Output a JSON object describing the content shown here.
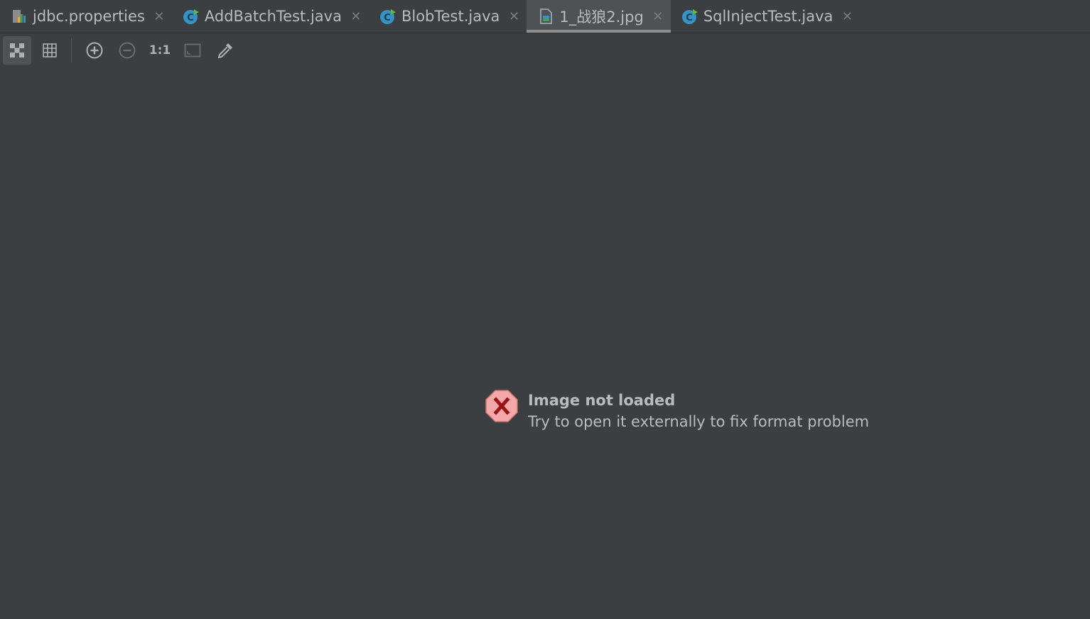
{
  "tabs": [
    {
      "label": "jdbc.properties",
      "icon": "properties-file-icon",
      "active": false
    },
    {
      "label": "AddBatchTest.java",
      "icon": "java-class-icon",
      "active": false
    },
    {
      "label": "BlobTest.java",
      "icon": "java-class-icon",
      "active": false
    },
    {
      "label": "1_战狼2.jpg",
      "icon": "image-file-icon",
      "active": true
    },
    {
      "label": "SqlInjectTest.java",
      "icon": "java-class-icon",
      "active": false
    }
  ],
  "toolbar": {
    "chessboard": "chessboard-icon",
    "grid": "grid-icon",
    "zoom_in": "zoom-in-icon",
    "zoom_out": "zoom-out-icon",
    "actual_size_label": "1:1",
    "fit": "fit-to-window-icon",
    "color_picker": "eyedropper-icon"
  },
  "error": {
    "title": "Image not loaded",
    "message": "Try to open it externally to fix format problem"
  },
  "colors": {
    "background": "#3c3f41",
    "active_tab": "#4e5254",
    "text": "#bbbbbb",
    "error_icon_fill": "#f3a9a9",
    "error_icon_mark": "#9b1414"
  }
}
